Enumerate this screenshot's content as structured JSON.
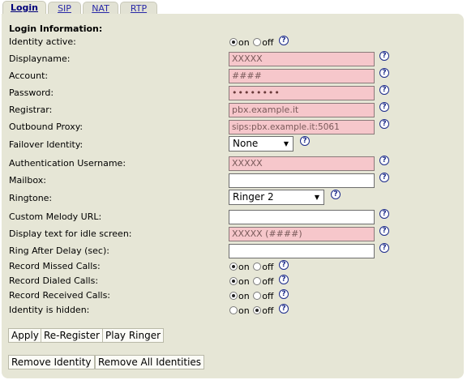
{
  "tabs": [
    {
      "label": "Login"
    },
    {
      "label": "SIP"
    },
    {
      "label": "NAT"
    },
    {
      "label": "RTP"
    }
  ],
  "section_title": "Login Information:",
  "fields": {
    "identity_active": {
      "label": "Identity active:",
      "on": "on",
      "off": "off",
      "selected": "on"
    },
    "displayname": {
      "label": "Displayname:",
      "value": "XXXXX"
    },
    "account": {
      "label": "Account:",
      "value": "####"
    },
    "password": {
      "label": "Password:",
      "value": "••••••••"
    },
    "registrar": {
      "label": "Registrar:",
      "value": "pbx.example.it"
    },
    "outbound_proxy": {
      "label": "Outbound Proxy:",
      "value": "sips:pbx.example.it:5061"
    },
    "failover_identity": {
      "label": "Failover Identity:",
      "value": "None"
    },
    "auth_username": {
      "label": "Authentication Username:",
      "value": "XXXXX"
    },
    "mailbox": {
      "label": "Mailbox:",
      "value": ""
    },
    "ringtone": {
      "label": "Ringtone:",
      "value": "Ringer 2"
    },
    "custom_melody_url": {
      "label": "Custom Melody URL:",
      "value": ""
    },
    "idle_text": {
      "label": "Display text for idle screen:",
      "value": "XXXXX (####)"
    },
    "ring_after_delay": {
      "label": "Ring After Delay (sec):",
      "value": ""
    },
    "record_missed": {
      "label": "Record Missed Calls:",
      "on": "on",
      "off": "off",
      "selected": "on"
    },
    "record_dialed": {
      "label": "Record Dialed Calls:",
      "on": "on",
      "off": "off",
      "selected": "on"
    },
    "record_received": {
      "label": "Record Received Calls:",
      "on": "on",
      "off": "off",
      "selected": "on"
    },
    "identity_hidden": {
      "label": "Identity is hidden:",
      "on": "on",
      "off": "off",
      "selected": "off"
    }
  },
  "help_symbol": "?",
  "buttons": {
    "apply": "Apply",
    "reregister": "Re-Register",
    "play_ringer": "Play Ringer",
    "remove_identity": "Remove Identity",
    "remove_all": "Remove All Identities"
  },
  "icons": {
    "select_arrow": "▼",
    "help": "help-icon"
  }
}
